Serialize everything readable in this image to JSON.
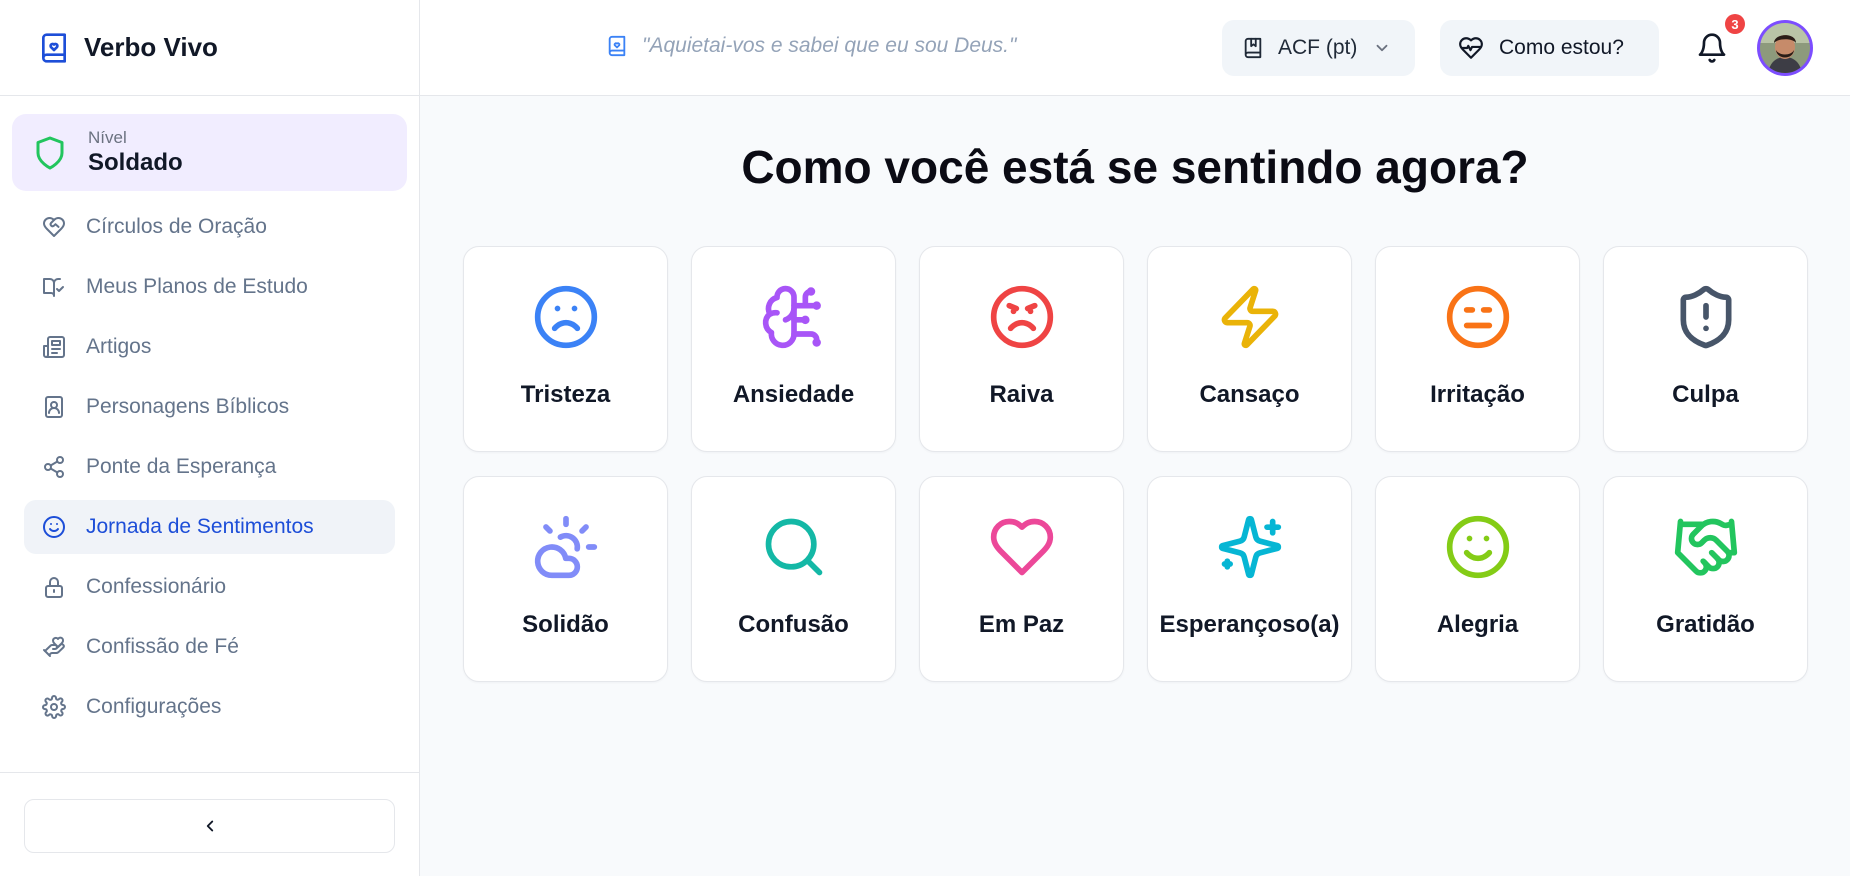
{
  "app": {
    "name": "Verbo Vivo"
  },
  "sidebar": {
    "level": {
      "label": "Nível",
      "value": "Soldado"
    },
    "items": [
      {
        "label": "Círculos de Oração",
        "icon": "heart-handshake-icon",
        "active": false
      },
      {
        "label": "Meus Planos de Estudo",
        "icon": "book-check-icon",
        "active": false
      },
      {
        "label": "Artigos",
        "icon": "newspaper-icon",
        "active": false
      },
      {
        "label": "Personagens Bíblicos",
        "icon": "contact-book-icon",
        "active": false
      },
      {
        "label": "Ponte da Esperança",
        "icon": "share-icon",
        "active": false
      },
      {
        "label": "Jornada de Sentimentos",
        "icon": "smile-icon",
        "active": true
      },
      {
        "label": "Confessionário",
        "icon": "lock-icon",
        "active": false
      },
      {
        "label": "Confissão de Fé",
        "icon": "hand-heart-icon",
        "active": false
      },
      {
        "label": "Configurações",
        "icon": "gear-icon",
        "active": false
      }
    ]
  },
  "header": {
    "verse": "\"Aquietai-vos e sabei que eu sou Deus.\"",
    "version": "ACF (pt)",
    "mood_button": "Como estou?",
    "notifications_count": "3"
  },
  "main": {
    "title": "Como você está se sentindo agora?",
    "emotions": [
      {
        "label": "Tristeza",
        "icon": "frown-icon",
        "color": "#3b82f6"
      },
      {
        "label": "Ansiedade",
        "icon": "brain-circuit-icon",
        "color": "#a855f7"
      },
      {
        "label": "Raiva",
        "icon": "angry-icon",
        "color": "#ef4444"
      },
      {
        "label": "Cansaço",
        "icon": "zap-icon",
        "color": "#eab308"
      },
      {
        "label": "Irritação",
        "icon": "meh-icon",
        "color": "#f97316"
      },
      {
        "label": "Culpa",
        "icon": "shield-alert-icon",
        "color": "#475569"
      },
      {
        "label": "Solidão",
        "icon": "cloud-sun-icon",
        "color": "#818cf8"
      },
      {
        "label": "Confusão",
        "icon": "search-icon",
        "color": "#14b8a6"
      },
      {
        "label": "Em Paz",
        "icon": "heart-icon",
        "color": "#ec4899"
      },
      {
        "label": "Esperançoso(a)",
        "icon": "sparkles-icon",
        "color": "#06b6d4"
      },
      {
        "label": "Alegria",
        "icon": "smile-icon",
        "color": "#84cc16"
      },
      {
        "label": "Gratidão",
        "icon": "handshake-icon",
        "color": "#22c55e"
      }
    ]
  }
}
